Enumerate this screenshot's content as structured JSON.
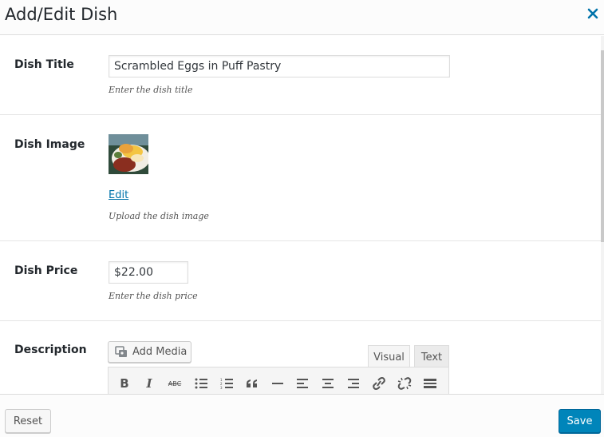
{
  "header": {
    "title": "Add/Edit Dish"
  },
  "fields": {
    "title": {
      "label": "Dish Title",
      "value": "Scrambled Eggs in Puff Pastry",
      "help": "Enter the dish title"
    },
    "image": {
      "label": "Dish Image",
      "edit_label": "Edit",
      "help": "Upload the dish image"
    },
    "price": {
      "label": "Dish Price",
      "value": "$22.00",
      "help": "Enter the dish price"
    },
    "description": {
      "label": "Description",
      "add_media_label": "Add Media"
    }
  },
  "editor": {
    "tabs": [
      "Visual",
      "Text"
    ],
    "active_tab": "Visual",
    "toolbar": [
      "bold",
      "italic",
      "strikethrough",
      "bulleted-list",
      "numbered-list",
      "blockquote",
      "horizontal-rule",
      "align-left",
      "align-center",
      "align-right",
      "insert-link",
      "remove-link",
      "toolbar-toggle"
    ],
    "bold_glyph": "B",
    "italic_glyph": "I",
    "strike_glyph": "ABC"
  },
  "footer": {
    "reset_label": "Reset",
    "save_label": "Save"
  },
  "colors": {
    "accent": "#0085ba",
    "link": "#0073aa",
    "close": "#0073aa"
  },
  "icons": {
    "close": "close-icon",
    "media": "media-icon"
  }
}
